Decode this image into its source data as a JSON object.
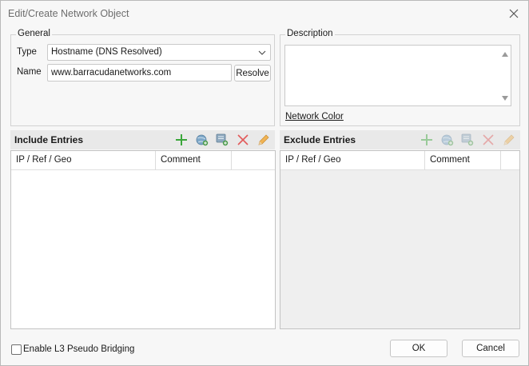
{
  "window": {
    "title": "Edit/Create Network Object"
  },
  "general": {
    "group_label": "General",
    "type_label": "Type",
    "type_value": "Hostname (DNS Resolved)",
    "name_label": "Name",
    "name_value": "www.barracudanetworks.com",
    "resolve_label": "Resolve"
  },
  "description": {
    "group_label": "Description",
    "network_color_label": "Network Color"
  },
  "include": {
    "title": "Include Entries",
    "columns": [
      "IP / Ref / Geo",
      "Comment"
    ]
  },
  "exclude": {
    "title": "Exclude Entries",
    "columns": [
      "IP / Ref / Geo",
      "Comment"
    ]
  },
  "footer": {
    "pseudo_bridging_label": "Enable L3 Pseudo Bridging",
    "pseudo_bridging_checked": false,
    "ok_label": "OK",
    "cancel_label": "Cancel"
  },
  "colors": {
    "add": "#3aa63a",
    "delete": "#e25b5b",
    "edit": "#e9a23b",
    "disabled_list_bg": "#efefef"
  }
}
